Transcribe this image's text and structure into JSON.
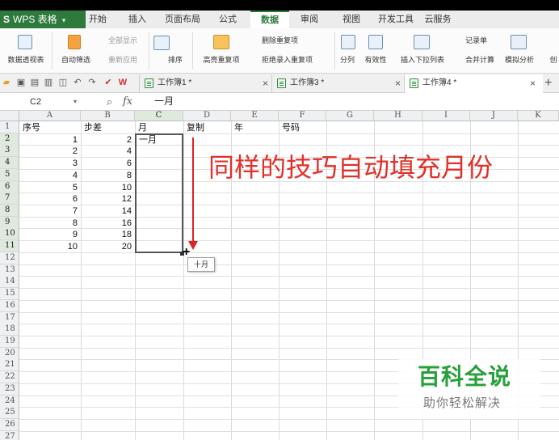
{
  "app": {
    "logo": "WPS 表格",
    "tabs": [
      "开始",
      "插入",
      "页面布局",
      "公式",
      "数据",
      "审阅",
      "视图",
      "开发工具",
      "云服务"
    ],
    "active_tab": "数据"
  },
  "ribbon": {
    "items": [
      "数据透视表",
      "自动筛选",
      "全部显示",
      "重新应用",
      "排序",
      "高亮重复项",
      "删除重复项",
      "拒绝录入重复项",
      "分列",
      "有效性",
      "插入下拉列表",
      "记录单",
      "合并计算",
      "模拟分析",
      "创"
    ]
  },
  "doc_tabs": [
    "工作簿1 *",
    "工作簿3 *",
    "工作簿4 *"
  ],
  "active_doc": "工作簿4 *",
  "formula_bar": {
    "name_box": "C2",
    "fx": "fx",
    "value": "一月"
  },
  "columns": [
    "A",
    "B",
    "C",
    "D",
    "E",
    "F",
    "G",
    "H",
    "I",
    "J",
    "K"
  ],
  "rows": [
    "1",
    "2",
    "3",
    "4",
    "5",
    "6",
    "7",
    "8",
    "9",
    "10",
    "11",
    "12",
    "13",
    "14",
    "15",
    "16",
    "17",
    "18",
    "19",
    "20",
    "21",
    "22",
    "23",
    "24",
    "25",
    "26",
    "27"
  ],
  "headers_row": {
    "A": "序号",
    "B": "步差",
    "C": "月",
    "D": "复制",
    "E": "年",
    "F": "号码"
  },
  "col_a": [
    "1",
    "2",
    "3",
    "4",
    "5",
    "6",
    "7",
    "8",
    "9",
    "10"
  ],
  "col_b": [
    "2",
    "4",
    "6",
    "8",
    "10",
    "12",
    "14",
    "16",
    "18",
    "20"
  ],
  "c2": "一月",
  "fill_tip": "十月",
  "annotation": "同样的技巧自动填充月份",
  "watermark": {
    "title": "百科全说",
    "subtitle": "助你轻松解决"
  },
  "colors": {
    "accent": "#2d7a3c",
    "annotation": "#e0312a",
    "watermark": "#27a03a"
  }
}
